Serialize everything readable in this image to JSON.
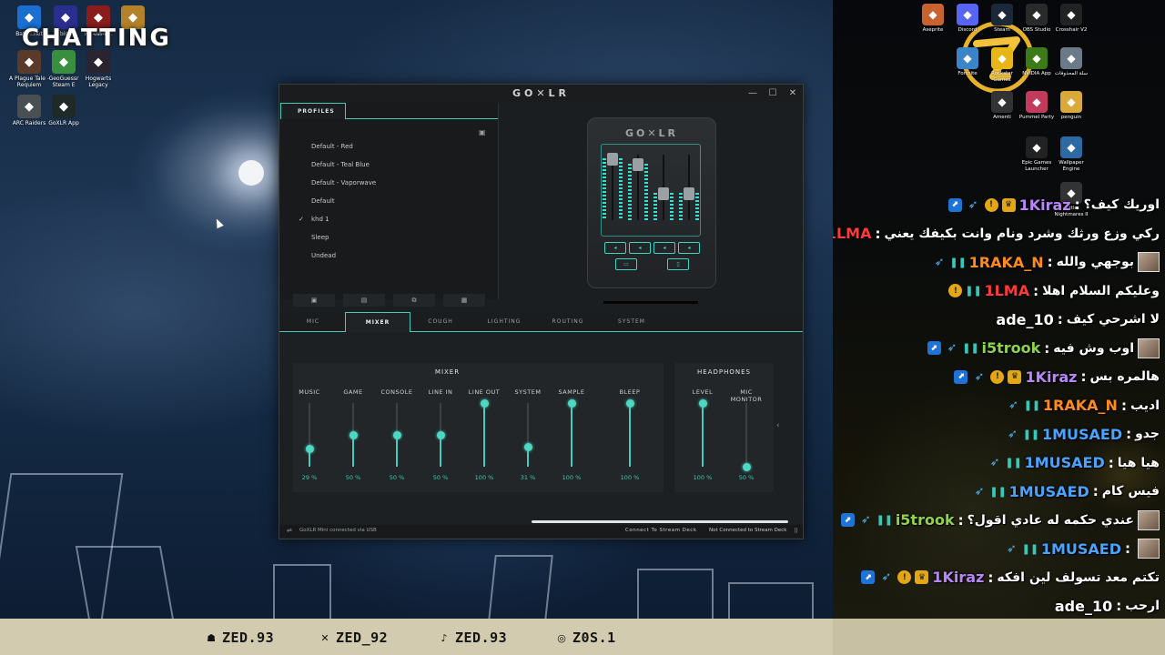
{
  "overlay": {
    "title": "CHATTING"
  },
  "desktop_icons": [
    {
      "label": "Battle.net",
      "icon": "battlenet-icon",
      "color": "#1a6fd1"
    },
    {
      "label": "Ubisoft",
      "icon": "ubisoft-icon",
      "color": "#2a2f8f"
    },
    {
      "label": "REANIMAL",
      "icon": "reanimal-icon",
      "color": "#8a1c1c"
    },
    {
      "label": "",
      "icon": "game-icon",
      "color": "#b4822a"
    },
    {
      "label": "A Plague Tale - Requiem",
      "icon": "plague-tale-icon",
      "color": "#5a3b2a"
    },
    {
      "label": "GeoGuessr Steam E",
      "icon": "geoguessr-icon",
      "color": "#3a8f3e"
    },
    {
      "label": "Hogwarts Legacy",
      "icon": "hogwarts-icon",
      "color": "#2a2430"
    },
    {
      "label": "ARC Raiders",
      "icon": "arc-raiders-icon",
      "color": "#4a4f54"
    },
    {
      "label": "GoXLR App",
      "icon": "goxlr-app-icon",
      "color": "#1f2a28"
    }
  ],
  "goxlr": {
    "title": "GO✕LR",
    "profiles_tab": "PROFILES",
    "profiles": [
      "Default - Red",
      "Default - Teal Blue",
      "Default - Vaporwave",
      "Default",
      "khd 1",
      "Sleep",
      "Undead"
    ],
    "active_profile_index": 4,
    "check_mark": "✓",
    "device_logo": "GO✕LR",
    "tabs": [
      "MIC",
      "MIXER",
      "COUGH",
      "LIGHTING",
      "ROUTING",
      "SYSTEM"
    ],
    "active_tab": "MIXER",
    "mixer_title": "MIXER",
    "headphones_title": "HEADPHONES",
    "channels": [
      {
        "label": "MUSIC",
        "value": "29 %",
        "level": 0.29
      },
      {
        "label": "GAME",
        "value": "50 %",
        "level": 0.5
      },
      {
        "label": "CONSOLE",
        "value": "50 %",
        "level": 0.5
      },
      {
        "label": "LINE IN",
        "value": "50 %",
        "level": 0.5
      },
      {
        "label": "LINE OUT",
        "value": "100 %",
        "level": 1.0
      },
      {
        "label": "SYSTEM",
        "value": "31 %",
        "level": 0.31
      },
      {
        "label": "SAMPLE",
        "value": "100 %",
        "level": 1.0
      },
      {
        "label": "BLEEP",
        "value": "100 %",
        "level": 1.0
      }
    ],
    "headphone_channels": [
      {
        "label": "LEVEL",
        "value": "100 %",
        "level": 1.0
      },
      {
        "label": "MIC MONITOR",
        "value": "50 %",
        "level": 0.0
      }
    ],
    "status_text": "GoXLR Mini connected via USB",
    "connect_stream_deck": "Connect To Stream Deck",
    "not_connected": "Not Connected to Stream Deck",
    "accent_color": "#4ac9b9"
  },
  "right_icons": [
    {
      "label": "Aseprite",
      "icon": "aseprite-icon",
      "color": "#c8622e"
    },
    {
      "label": "Discord",
      "icon": "discord-icon",
      "color": "#5865f2"
    },
    {
      "label": "Steam",
      "icon": "steam-icon",
      "color": "#1b2838"
    },
    {
      "label": "OBS Studio",
      "icon": "obs-icon",
      "color": "#2a2a2a"
    },
    {
      "label": "Crosshair V2",
      "icon": "crosshair-icon",
      "color": "#222"
    },
    {
      "label": "Fortnite",
      "icon": "fortnite-icon",
      "color": "#3a84c7"
    },
    {
      "label": "Rockstar Games",
      "icon": "rockstar-icon",
      "color": "#e8b614"
    },
    {
      "label": "NVIDIA App",
      "icon": "nvidia-icon",
      "color": "#3b7a17"
    },
    {
      "label": "سلة المحذوفات",
      "icon": "recycle-bin-icon",
      "color": "#6a7a88"
    },
    {
      "label": "Amenti",
      "icon": "amenti-icon",
      "color": "#333"
    },
    {
      "label": "Pummel Party",
      "icon": "pummel-party-icon",
      "color": "#c23a5c"
    },
    {
      "label": "penguin",
      "icon": "folder-icon",
      "color": "#d9a93a"
    },
    {
      "label": "Epic Games Launcher",
      "icon": "epic-icon",
      "color": "#222"
    },
    {
      "label": "Wallpaper Engine",
      "icon": "wallpaper-engine-icon",
      "color": "#2d6aa3"
    },
    {
      "label": "Little Nightmares II",
      "icon": "little-nightmares-icon",
      "color": "#333"
    }
  ],
  "chat": [
    {
      "badges": [
        "arrow",
        "wing",
        "gold",
        "crown"
      ],
      "user": "1Kiraz",
      "color": "#b886f7",
      "text": "اوريك كيف؟"
    },
    {
      "badges": [
        "gold",
        "gg"
      ],
      "user": "1LMA",
      "color": "#ff3a3a",
      "text": "ركي وزع ورثك وشرد ونام وانت بكيفك يعني"
    },
    {
      "badges": [
        "wing",
        "gg"
      ],
      "user": "1RAKA_N",
      "color": "#ff8a1e",
      "text": "بوجهي والله",
      "avatar": true
    },
    {
      "badges": [
        "gold",
        "gg"
      ],
      "user": "1LMA",
      "color": "#ff3a3a",
      "text": "وعليكم السلام اهلا"
    },
    {
      "badges": [],
      "user": "ade_10",
      "color": "#ffffff",
      "text": "لا اشرحي كيف"
    },
    {
      "badges": [
        "arrow",
        "wing",
        "gg"
      ],
      "user": "i5trook",
      "color": "#8fd34c",
      "text": "اوب وش فيه",
      "avatar": true
    },
    {
      "badges": [
        "arrow",
        "wing",
        "gold",
        "crown"
      ],
      "user": "1Kiraz",
      "color": "#b886f7",
      "text": "هالمره بس"
    },
    {
      "badges": [
        "wing",
        "gg"
      ],
      "user": "1RAKA_N",
      "color": "#ff8a1e",
      "text": "اديب"
    },
    {
      "badges": [
        "wing",
        "gg"
      ],
      "user": "1MUSAED",
      "color": "#4aa3ff",
      "text": "جدو"
    },
    {
      "badges": [
        "wing",
        "gg"
      ],
      "user": "1MUSAED",
      "color": "#4aa3ff",
      "text": "هيا هيا"
    },
    {
      "badges": [
        "wing",
        "gg"
      ],
      "user": "1MUSAED",
      "color": "#4aa3ff",
      "text": "فيس كام"
    },
    {
      "badges": [
        "arrow",
        "wing",
        "gg"
      ],
      "user": "i5trook",
      "color": "#8fd34c",
      "text": "عندي حكمه له عادي اقول؟",
      "avatar": true
    },
    {
      "badges": [
        "wing",
        "gg"
      ],
      "user": "1MUSAED",
      "color": "#4aa3ff",
      "text": "",
      "avatar": true
    },
    {
      "badges": [
        "arrow",
        "wing",
        "gold",
        "crown"
      ],
      "user": "1Kiraz",
      "color": "#b886f7",
      "text": "تكتم معد تسولف لين افكه"
    },
    {
      "badges": [],
      "user": "ade_10",
      "color": "#ffffff",
      "text": "ارحب"
    }
  ],
  "socials": [
    {
      "icon": "snapchat-icon",
      "glyph": "☗",
      "handle": "ZED.93"
    },
    {
      "icon": "x-icon",
      "glyph": "✕",
      "handle": "ZED_92"
    },
    {
      "icon": "tiktok-icon",
      "glyph": "♪",
      "handle": "ZED.93"
    },
    {
      "icon": "instagram-icon",
      "glyph": "◎",
      "handle": "Z0S.1"
    }
  ]
}
